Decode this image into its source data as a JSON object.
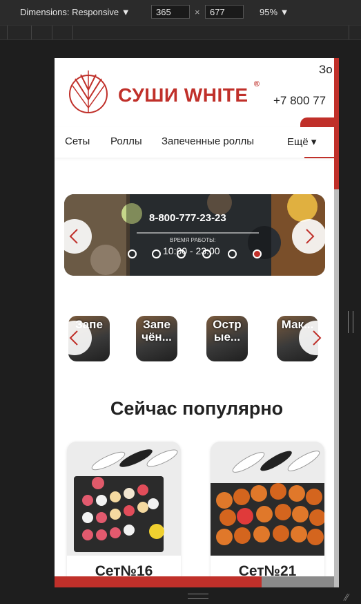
{
  "devtools": {
    "dimensions_label": "Dimensions: Responsive",
    "width": "365",
    "times": "×",
    "height": "677",
    "zoom": "95%"
  },
  "site": {
    "brand": "СУШИ WHITE",
    "brand_mark": "®",
    "phone": "+7 800 77",
    "top_right": "Зо"
  },
  "nav": {
    "items": [
      "Сеты",
      "Роллы",
      "Запеченные роллы"
    ],
    "more": "Ещё"
  },
  "banner": {
    "phone": "8-800-777-23-23",
    "subtitle": "ВРЕМЯ РАБОТЫ:",
    "hours": "10:00 - 23:00",
    "active_slide": 6,
    "slide_count": 6
  },
  "categories": [
    "Запе",
    "Запе чён...",
    "Остр ые...",
    "Мак..."
  ],
  "popular": {
    "heading": "Сейчас популярно",
    "cards": [
      "Сет№16",
      "Сет№21"
    ]
  },
  "colors": {
    "accent": "#c0302a"
  }
}
